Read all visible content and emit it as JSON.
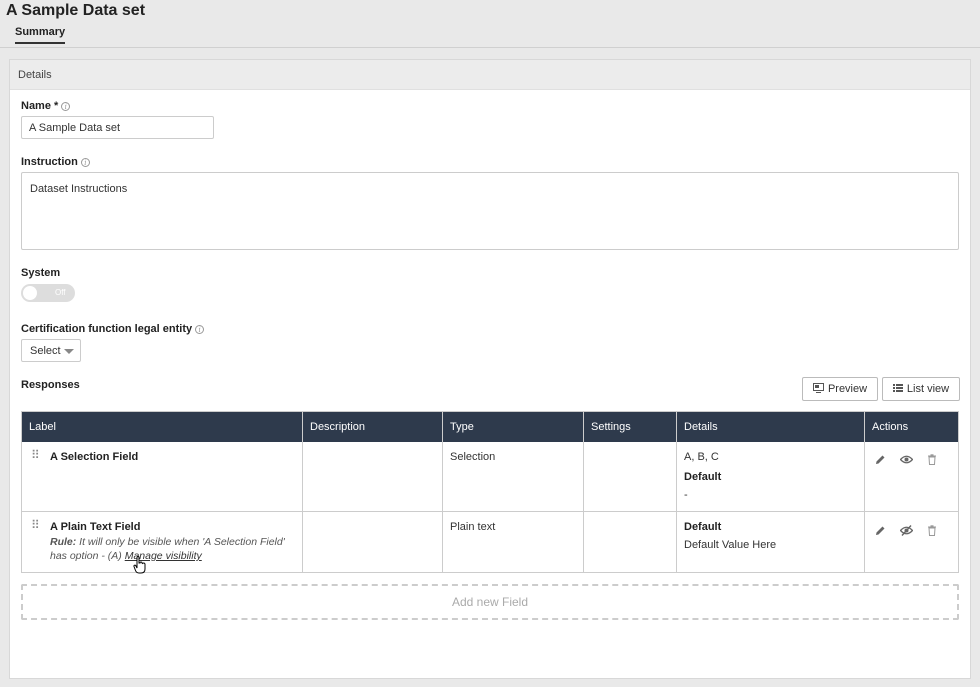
{
  "header": {
    "title": "A Sample Data set",
    "tab_summary": "Summary"
  },
  "details": {
    "panel_title": "Details",
    "name_label": "Name *",
    "name_value": "A Sample Data set",
    "instruction_label": "Instruction",
    "instruction_value": "Dataset Instructions",
    "system_label": "System",
    "system_toggle": "Off",
    "legal_entity_label": "Certification function legal entity",
    "legal_entity_select": "Select"
  },
  "responses": {
    "title": "Responses",
    "preview_button": "Preview",
    "list_view_button": "List view",
    "columns": [
      "Label",
      "Description",
      "Type",
      "Settings",
      "Details",
      "Actions"
    ],
    "rows": [
      {
        "label": "A Selection Field",
        "description": "",
        "type": "Selection",
        "settings": "",
        "details_options": "A, B, C",
        "details_default_label": "Default",
        "details_default_value": "-",
        "visibility": "visible"
      },
      {
        "label": "A Plain Text Field",
        "rule_prefix": "Rule:",
        "rule_text": " It will only be visible when 'A Selection Field' has option - (A) ",
        "manage_link": "Manage visibility",
        "description": "",
        "type": "Plain text",
        "settings": "",
        "details_default_label": "Default",
        "details_default_value": "Default Value Here",
        "visibility": "hidden"
      }
    ],
    "add_field": "Add new Field"
  },
  "icons": {
    "edit": "pencil-icon",
    "view": "eye-icon",
    "hidden": "eye-off-icon",
    "delete": "trash-icon",
    "info": "info-icon",
    "drag": "drag-handle-icon"
  },
  "colors": {
    "table_header_bg": "#2e3a4c",
    "toggle_off": "#dddddd"
  }
}
